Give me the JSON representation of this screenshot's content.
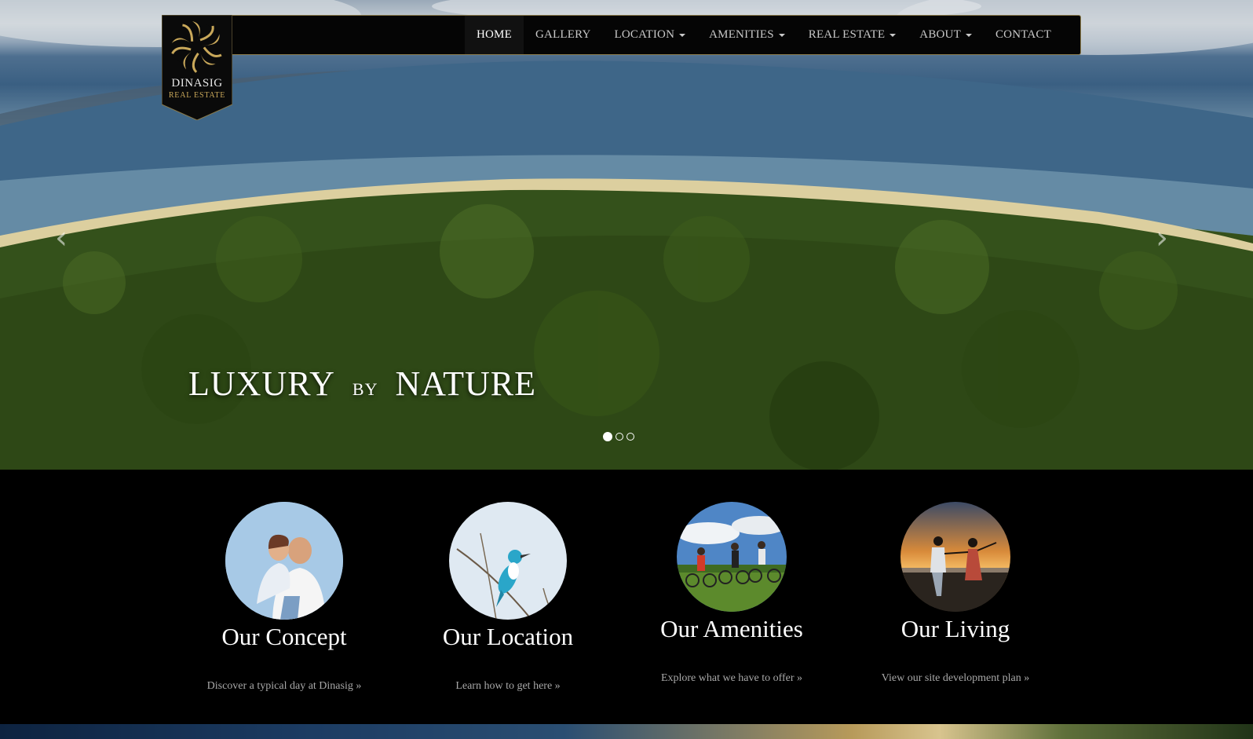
{
  "brand": {
    "name": "DINASIG",
    "subtitle": "REAL ESTATE"
  },
  "nav": {
    "items": [
      {
        "label": "HOME",
        "active": true,
        "dropdown": false
      },
      {
        "label": "GALLERY",
        "active": false,
        "dropdown": false
      },
      {
        "label": "LOCATION",
        "active": false,
        "dropdown": true
      },
      {
        "label": "AMENITIES",
        "active": false,
        "dropdown": true
      },
      {
        "label": "REAL ESTATE",
        "active": false,
        "dropdown": true
      },
      {
        "label": "ABOUT",
        "active": false,
        "dropdown": true
      },
      {
        "label": "CONTACT",
        "active": false,
        "dropdown": false
      }
    ]
  },
  "hero": {
    "caption_word1": "LUXURY",
    "caption_by": "BY",
    "caption_word2": "NATURE",
    "prev_icon": "chevron-left-icon",
    "next_icon": "chevron-right-icon",
    "slide_count": 3,
    "active_slide": 1
  },
  "features": [
    {
      "title": "Our Concept",
      "link": "Discover a typical day at Dinasig »",
      "image": "couple-portrait"
    },
    {
      "title": "Our Location",
      "link": "Learn how to get here »",
      "image": "kingfisher-bird"
    },
    {
      "title": "Our Amenities",
      "link": "Explore what we have to offer »",
      "image": "cyclists-field"
    },
    {
      "title": "Our Living",
      "link": "View our site development plan »",
      "image": "couple-sunset"
    }
  ],
  "colors": {
    "navbar_bg": "#050505",
    "navbar_border": "#8a7a4a",
    "accent_gold": "#c9a85a",
    "link_gray": "#a8a8a8"
  }
}
